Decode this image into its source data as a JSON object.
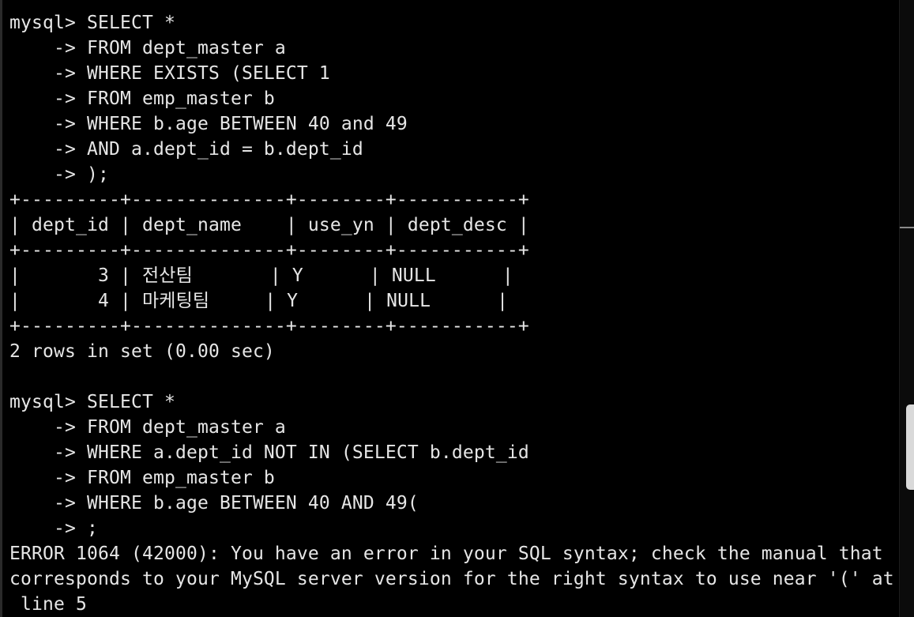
{
  "terminal": {
    "lines": [
      "mysql> SELECT *",
      "    -> FROM dept_master a",
      "    -> WHERE EXISTS (SELECT 1",
      "    -> FROM emp_master b",
      "    -> WHERE b.age BETWEEN 40 and 49",
      "    -> AND a.dept_id = b.dept_id",
      "    -> );",
      "+---------+--------------+--------+-----------+",
      "| dept_id | dept_name    | use_yn | dept_desc |",
      "+---------+--------------+--------+-----------+",
      "|       3 | 전산팀       | Y      | NULL      |",
      "|       4 | 마케팅팀     | Y      | NULL      |",
      "+---------+--------------+--------+-----------+",
      "2 rows in set (0.00 sec)",
      "",
      "mysql> SELECT *",
      "    -> FROM dept_master a",
      "    -> WHERE a.dept_id NOT IN (SELECT b.dept_id",
      "    -> FROM emp_master b",
      "    -> WHERE b.age BETWEEN 40 AND 49(",
      "    -> ;",
      "ERROR 1064 (42000): You have an error in your SQL syntax; check the manual that",
      "corresponds to your MySQL server version for the right syntax to use near '(' at",
      " line 5"
    ]
  },
  "colors": {
    "background": "#000000",
    "text": "#e6e6e6",
    "scroll_thumb": "#d9d9d9"
  }
}
